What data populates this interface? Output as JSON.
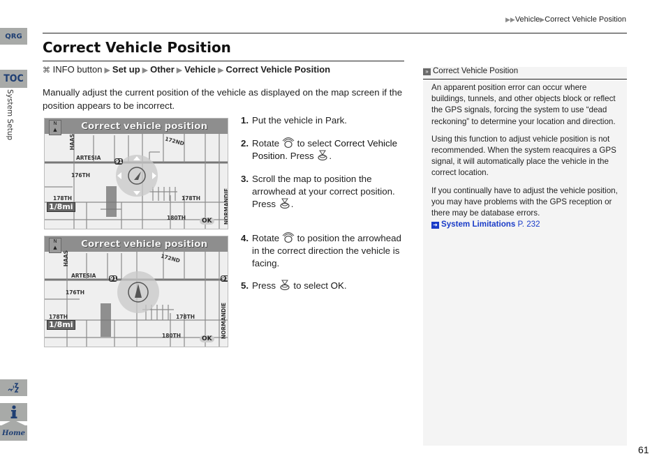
{
  "sidebar": {
    "qrg_label": "QRG",
    "toc_label": "TOC",
    "section_label": "System Setup",
    "bottom_icons": [
      "voice-command-icon",
      "info-icon",
      "home-icon"
    ],
    "home_label": "Home"
  },
  "header": {
    "breadcrumb": [
      "Vehicle",
      "Correct Vehicle Position"
    ]
  },
  "page": {
    "title": "Correct Vehicle Position",
    "path": {
      "start": "INFO button",
      "items": [
        "Set up",
        "Other",
        "Vehicle",
        "Correct Vehicle Position"
      ]
    },
    "intro": "Manually adjust the current position of the vehicle as displayed on the map screen if the position appears to be incorrect.",
    "maps": [
      {
        "title": "Correct vehicle position",
        "labels": {
          "haas": "HAAS",
          "artesia": "ARTESIA",
          "s176": "176TH",
          "s178a": "178TH",
          "s178b": "178TH",
          "s180": "180TH",
          "normandie": "NORMANDIE",
          "route": "91",
          "s172": "172ND"
        },
        "scale": "1/8mi",
        "ok": "OK",
        "mode": "move"
      },
      {
        "title": "Correct vehicle position",
        "labels": {
          "haas": "HAAS",
          "artesia": "ARTESIA",
          "s176": "176TH",
          "s178a": "178TH",
          "s178b": "178TH",
          "s180": "180TH",
          "normandie": "NORMANDIE",
          "route": "91",
          "s172": "172ND"
        },
        "scale": "1/8mi",
        "ok": "OK",
        "mode": "rotate"
      }
    ],
    "steps": [
      {
        "num": "1.",
        "parts": [
          "Put the vehicle in Park."
        ]
      },
      {
        "num": "2.",
        "parts": [
          "Rotate",
          "to select",
          "Correct Vehicle Position",
          ". Press",
          "."
        ]
      },
      {
        "num": "3.",
        "parts": [
          "Scroll the map to position the arrowhead at your correct position. Press",
          "."
        ]
      },
      {
        "num": "4.",
        "parts": [
          "Rotate",
          "to position the arrowhead in the correct direction the vehicle is facing."
        ]
      },
      {
        "num": "5.",
        "parts": [
          "Press",
          "to select",
          "OK",
          "."
        ]
      }
    ]
  },
  "note": {
    "heading": "Correct Vehicle Position",
    "paragraphs": [
      "An apparent position error can occur where buildings, tunnels, and other objects block or reflect the GPS signals, forcing the system to use “dead reckoning” to determine your location and direction.",
      "Using this function to adjust vehicle position is not recommended. When the system reacquires a GPS signal, it will automatically place the vehicle in the correct location.",
      "If you continually have to adjust the vehicle position, you may have problems with the GPS reception or there may be database errors."
    ],
    "xref": {
      "label": "System Limitations",
      "page": "P. 232"
    }
  },
  "footer": {
    "page_number": "61"
  },
  "colors": {
    "tab_bg": "#a8aaa8",
    "tab_text": "#1f3f73",
    "link": "#1a3cc8",
    "note_bg": "#f4f4f4"
  }
}
